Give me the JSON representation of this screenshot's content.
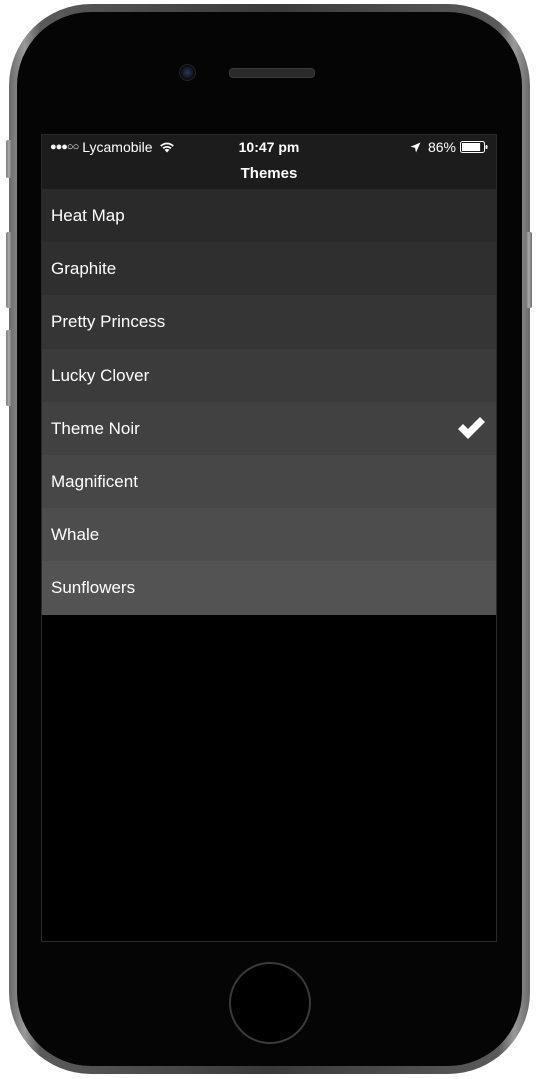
{
  "status_bar": {
    "signal": "●●●○○",
    "carrier": "Lycamobile",
    "time": "10:47 pm",
    "battery": "86%",
    "battery_level": 0.86,
    "icons": [
      "wifi-icon",
      "location-arrow-icon",
      "battery-icon"
    ]
  },
  "nav": {
    "title": "Themes"
  },
  "themes": {
    "items": [
      {
        "label": "Heat Map",
        "selected": false,
        "bg": "#2a2a2a"
      },
      {
        "label": "Graphite",
        "selected": false,
        "bg": "#2f2f2f"
      },
      {
        "label": "Pretty Princess",
        "selected": false,
        "bg": "#353535"
      },
      {
        "label": "Lucky Clover",
        "selected": false,
        "bg": "#3b3b3b"
      },
      {
        "label": "Theme Noir",
        "selected": true,
        "bg": "#414141"
      },
      {
        "label": "Magnificent",
        "selected": false,
        "bg": "#474747"
      },
      {
        "label": "Whale",
        "selected": false,
        "bg": "#4d4d4d"
      },
      {
        "label": "Sunflowers",
        "selected": false,
        "bg": "#535353"
      }
    ],
    "selected_icon": "checkmark-icon"
  },
  "colors": {
    "screen_bg": "#000000",
    "nav_bg": "#1c1c1c",
    "text": "#ffffff"
  }
}
